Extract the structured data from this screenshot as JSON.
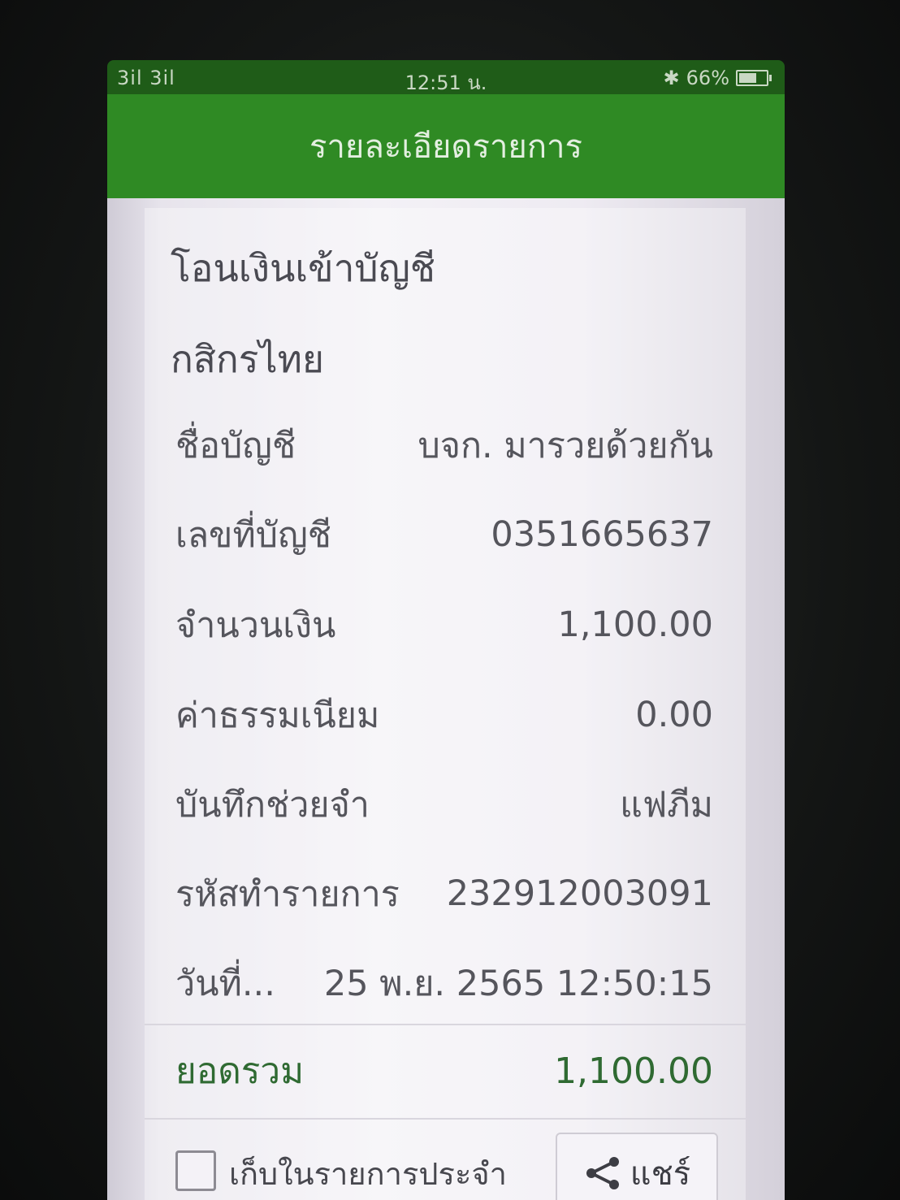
{
  "status_bar": {
    "signal": "3il 3il",
    "time": "12:51 น.",
    "bluetooth": "✱",
    "battery_percent": "66%",
    "battery_level": 0.66
  },
  "app_bar": {
    "title": "รายละเอียดรายการ"
  },
  "transaction": {
    "type": "โอนเงินเข้าบัญชี",
    "bank": "กสิกรไทย",
    "rows": [
      {
        "label": "ชื่อบัญชี",
        "value": "บจก. มารวยด้วยกัน"
      },
      {
        "label": "เลขที่บัญชี",
        "value": "0351665637"
      },
      {
        "label": "จำนวนเงิน",
        "value": "1,100.00"
      },
      {
        "label": "ค่าธรรมเนียม",
        "value": "0.00"
      },
      {
        "label": "บันทึกช่วยจำ",
        "value": "แฟภีม"
      },
      {
        "label": "รหัสทำรายการ",
        "value": "232912003091"
      },
      {
        "label": "วันที่...",
        "value": "25 พ.ย. 2565 12:50:15"
      }
    ],
    "total_label": "ยอดรวม",
    "total_value": "1,100.00"
  },
  "actions": {
    "save_favorite_label": "เก็บในรายการประจำ",
    "save_favorite_checked": false,
    "share_label": "แชร์",
    "share_icon": "share-icon"
  },
  "colors": {
    "app_bar": "#2f8a24",
    "total_text": "#2f6a32"
  }
}
